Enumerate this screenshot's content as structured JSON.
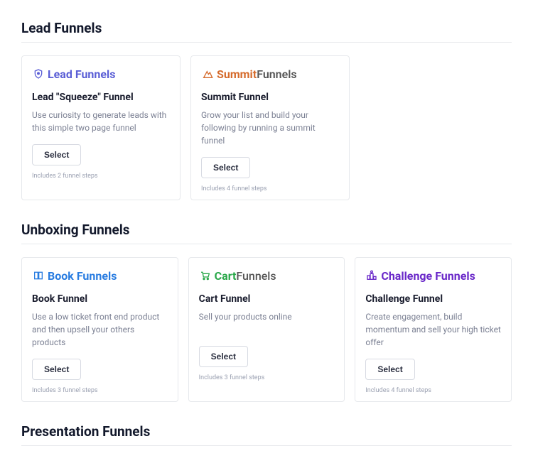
{
  "sections": [
    {
      "title": "Lead Funnels",
      "cards": [
        {
          "logo_icon": "lead",
          "logo_text_bold": "Lead",
          "logo_text_thin": "Funnels",
          "title": "Lead \"Squeeze\" Funnel",
          "desc": "Use curiosity to generate leads with this simple two page funnel",
          "select": "Select",
          "steps": "Includes 2 funnel steps"
        },
        {
          "logo_icon": "summit",
          "logo_text_bold": "Summit",
          "logo_text_thin": "Funnels",
          "title": "Summit Funnel",
          "desc": "Grow your list and build your following by running a summit funnel",
          "select": "Select",
          "steps": "Includes 4 funnel steps"
        }
      ]
    },
    {
      "title": "Unboxing Funnels",
      "cards": [
        {
          "logo_icon": "book",
          "logo_text_bold": "Book",
          "logo_text_thin": "Funnels",
          "title": "Book Funnel",
          "desc": "Use a low ticket front end product and then upsell your others products",
          "select": "Select",
          "steps": "Includes 3 funnel steps"
        },
        {
          "logo_icon": "cart",
          "logo_text_bold": "Cart",
          "logo_text_thin": "Funnels",
          "title": "Cart Funnel",
          "desc": "Sell your products online",
          "select": "Select",
          "steps": "Includes 3 funnel steps"
        },
        {
          "logo_icon": "challenge",
          "logo_text_bold": "Challenge",
          "logo_text_thin": "Funnels",
          "title": "Challenge Funnel",
          "desc": "Create engagement, build momentum and sell your high ticket offer",
          "select": "Select",
          "steps": "Includes 4 funnel steps"
        }
      ]
    },
    {
      "title": "Presentation Funnels",
      "cards": []
    }
  ]
}
